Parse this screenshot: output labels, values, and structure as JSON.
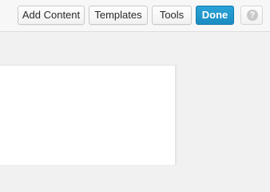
{
  "toolbar": {
    "add_content_label": "Add Content",
    "templates_label": "Templates",
    "tools_label": "Tools",
    "done_label": "Done",
    "help_icon": "question-circle-icon",
    "help_glyph": "?"
  },
  "colors": {
    "accent": "#1e98cf",
    "toolbar_bg": "#f7f7f7",
    "canvas_bg": "#f1f1f1",
    "page_bg": "#ffffff"
  }
}
